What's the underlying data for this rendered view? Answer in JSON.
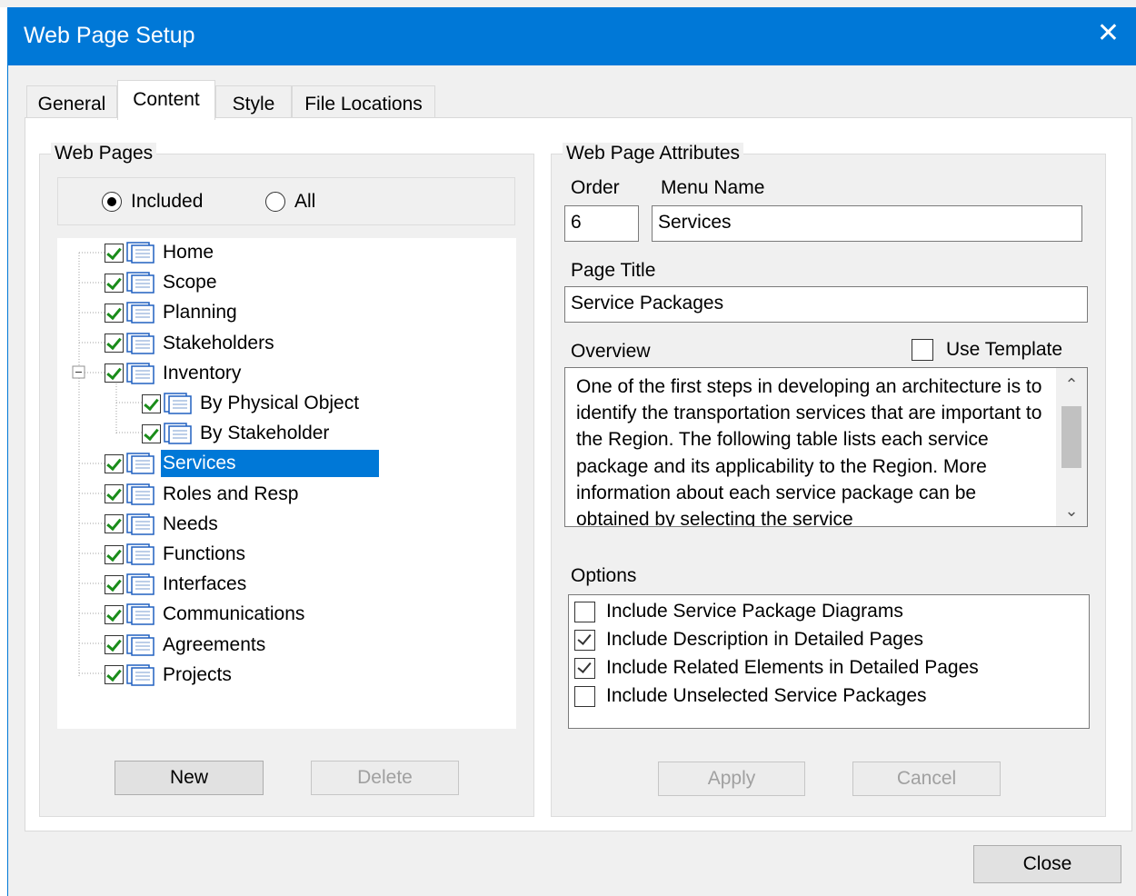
{
  "window": {
    "title": "Web Page Setup",
    "close_glyph": "✕"
  },
  "tabs": [
    {
      "label": "General",
      "active": false
    },
    {
      "label": "Content",
      "active": true
    },
    {
      "label": "Style",
      "active": false
    },
    {
      "label": "File Locations",
      "active": false
    }
  ],
  "web_pages": {
    "group_label": "Web Pages",
    "radio_included": "Included",
    "radio_all": "All",
    "selected_radio": "Included",
    "tree": [
      {
        "label": "Home",
        "checked": true
      },
      {
        "label": "Scope",
        "checked": true
      },
      {
        "label": "Planning",
        "checked": true
      },
      {
        "label": "Stakeholders",
        "checked": true
      },
      {
        "label": "Inventory",
        "checked": true,
        "expanded": true
      },
      {
        "label": "By Physical Object",
        "checked": true
      },
      {
        "label": "By Stakeholder",
        "checked": true
      },
      {
        "label": "Services",
        "checked": true,
        "selected": true
      },
      {
        "label": "Roles and Resp",
        "checked": true
      },
      {
        "label": "Needs",
        "checked": true
      },
      {
        "label": "Functions",
        "checked": true
      },
      {
        "label": "Interfaces",
        "checked": true
      },
      {
        "label": "Communications",
        "checked": true
      },
      {
        "label": "Agreements",
        "checked": true
      },
      {
        "label": "Projects",
        "checked": true
      }
    ],
    "new_label": "New",
    "delete_label": "Delete"
  },
  "attributes": {
    "group_label": "Web Page Attributes",
    "order_label": "Order",
    "order_value": "6",
    "menu_name_label": "Menu Name",
    "menu_name_value": "Services",
    "page_title_label": "Page Title",
    "page_title_value": "Service Packages",
    "overview_label": "Overview",
    "use_template_label": "Use Template",
    "use_template_checked": false,
    "overview_text": "One of the first steps in developing an architecture is to identify the transportation services that are important to the Region.  The following table lists each service package and its applicability to the Region.  More information about each service package can be obtained by selecting the service",
    "options_label": "Options",
    "options": [
      {
        "label": "Include Service Package Diagrams",
        "checked": false
      },
      {
        "label": "Include Description in Detailed Pages",
        "checked": true
      },
      {
        "label": "Include Related Elements in Detailed Pages",
        "checked": true
      },
      {
        "label": "Include Unselected Service Packages",
        "checked": false
      }
    ],
    "apply_label": "Apply",
    "cancel_label": "Cancel"
  },
  "footer": {
    "close_label": "Close"
  },
  "colors": {
    "accent": "#0078d7",
    "check": "#1a8c1a"
  }
}
